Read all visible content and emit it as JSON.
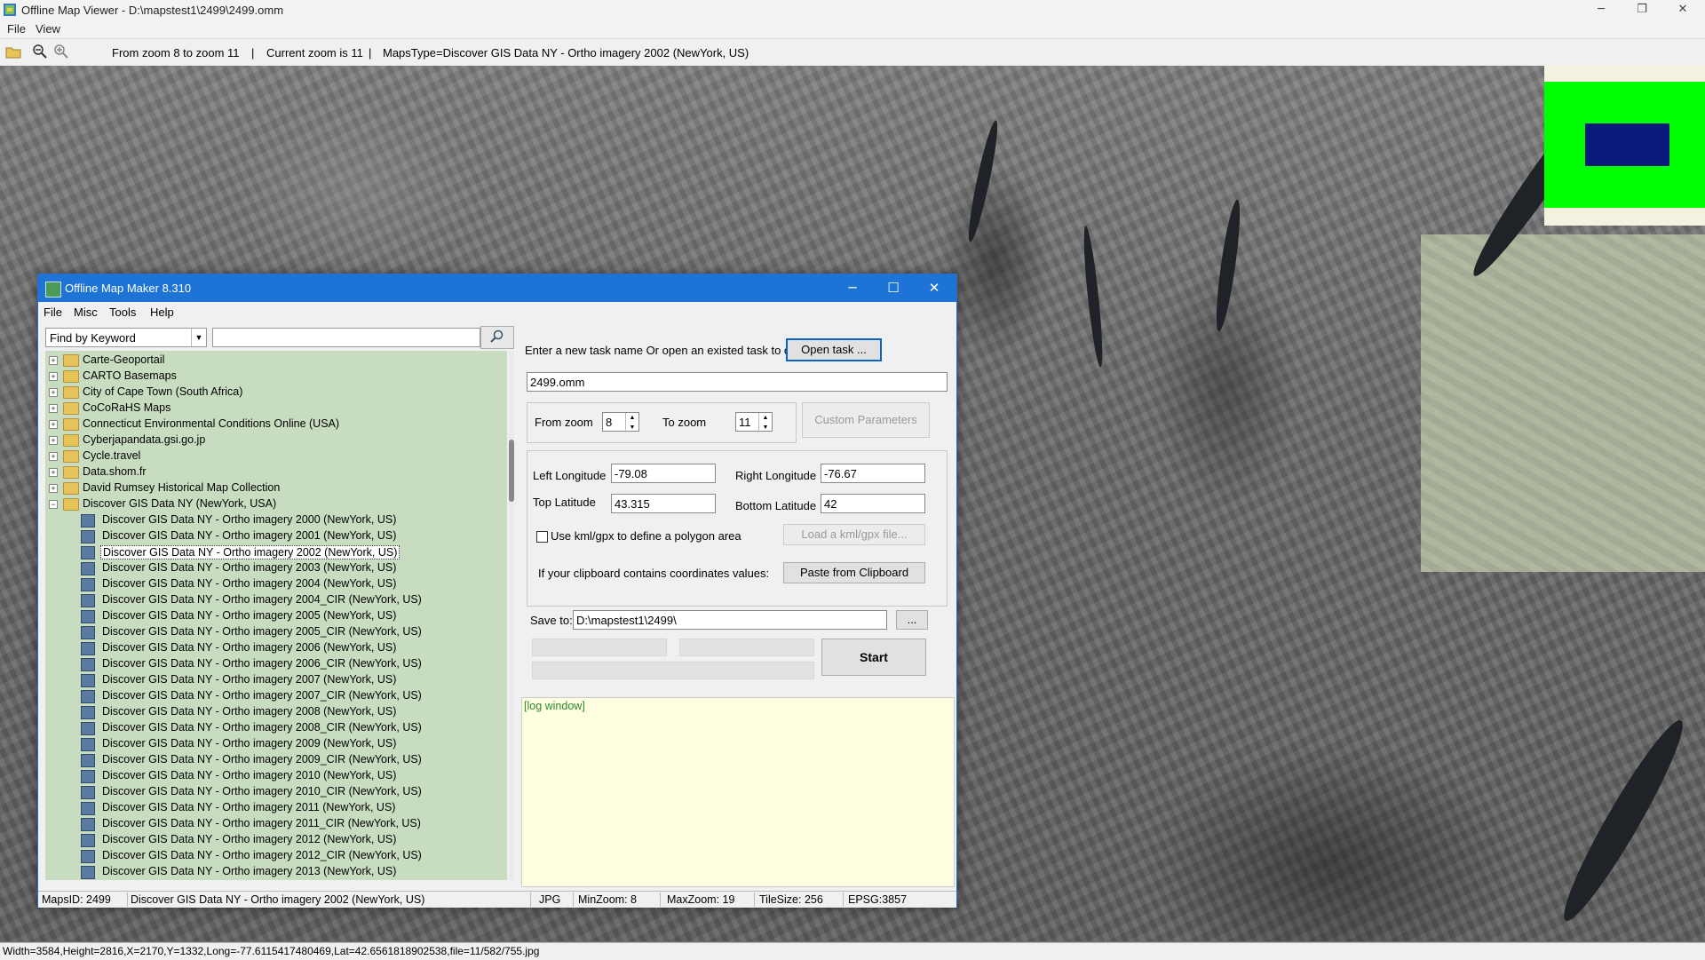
{
  "viewer": {
    "title": "Offline Map Viewer - D:\\mapstest1\\2499\\2499.omm",
    "menu": [
      "File",
      "View"
    ],
    "toolbar": {
      "zoom_range": "From zoom 8 to zoom 11",
      "current_zoom": "Current zoom is 11",
      "maps_type": "MapsType=Discover GIS Data NY - Ortho imagery 2002 (NewYork, US)"
    },
    "status": "Width=3584,Height=2816,X=2170,Y=1332,Long=-77.6115417480469,Lat=42.6561818902538,file=11/582/755.jpg"
  },
  "dialog": {
    "title": "Offline Map Maker 8.310",
    "menu": [
      "File",
      "Misc",
      "Tools",
      "Help"
    ],
    "search_mode": "Find by Keyword",
    "search_value": "",
    "tree": {
      "folders": [
        "Carte-Geoportail",
        "CARTO Basemaps",
        "City of Cape Town (South Africa)",
        "CoCoRaHS Maps",
        "Connecticut Environmental Conditions Online (USA)",
        "Cyberjapandata.gsi.go.jp",
        "Cycle.travel",
        "Data.shom.fr",
        "David Rumsey Historical Map Collection"
      ],
      "expanded_folder": "Discover GIS Data NY (NewYork, USA)",
      "children": [
        "Discover GIS Data NY - Ortho imagery 2000 (NewYork, US)",
        "Discover GIS Data NY - Ortho imagery 2001 (NewYork, US)",
        "Discover GIS Data NY - Ortho imagery 2002 (NewYork, US)",
        "Discover GIS Data NY - Ortho imagery 2003 (NewYork, US)",
        "Discover GIS Data NY - Ortho imagery 2004 (NewYork, US)",
        "Discover GIS Data NY - Ortho imagery 2004_CIR (NewYork, US)",
        "Discover GIS Data NY - Ortho imagery 2005 (NewYork, US)",
        "Discover GIS Data NY - Ortho imagery 2005_CIR (NewYork, US)",
        "Discover GIS Data NY - Ortho imagery 2006 (NewYork, US)",
        "Discover GIS Data NY - Ortho imagery 2006_CIR (NewYork, US)",
        "Discover GIS Data NY - Ortho imagery 2007 (NewYork, US)",
        "Discover GIS Data NY - Ortho imagery 2007_CIR (NewYork, US)",
        "Discover GIS Data NY - Ortho imagery 2008 (NewYork, US)",
        "Discover GIS Data NY - Ortho imagery 2008_CIR (NewYork, US)",
        "Discover GIS Data NY - Ortho imagery 2009 (NewYork, US)",
        "Discover GIS Data NY - Ortho imagery 2009_CIR (NewYork, US)",
        "Discover GIS Data NY - Ortho imagery 2010 (NewYork, US)",
        "Discover GIS Data NY - Ortho imagery 2010_CIR (NewYork, US)",
        "Discover GIS Data NY - Ortho imagery 2011 (NewYork, US)",
        "Discover GIS Data NY - Ortho imagery 2011_CIR (NewYork, US)",
        "Discover GIS Data NY - Ortho imagery 2012 (NewYork, US)",
        "Discover GIS Data NY - Ortho imagery 2012_CIR (NewYork, US)",
        "Discover GIS Data NY - Ortho imagery 2013 (NewYork, US)"
      ],
      "selected_child": "Discover GIS Data NY - Ortho imagery 2002 (NewYork, US)"
    },
    "task_prompt": "Enter a new task name Or open an existed task to continue:",
    "open_task_label": "Open task ...",
    "task_name": "2499.omm",
    "from_zoom_label": "From zoom",
    "from_zoom": "8",
    "to_zoom_label": "To zoom",
    "to_zoom": "11",
    "custom_params_label": "Custom Parameters",
    "left_lon_label": "Left Longitude",
    "left_lon": "-79.08",
    "right_lon_label": "Right Longitude",
    "right_lon": "-76.67",
    "top_lat_label": "Top Latitude",
    "top_lat": "43.315",
    "bottom_lat_label": "Bottom Latitude",
    "bottom_lat": "42",
    "kml_checkbox_label": "Use kml/gpx to define a polygon area",
    "kml_checked": false,
    "load_kml_label": "Load a kml/gpx file...",
    "clipboard_prompt": "If your clipboard contains coordinates values:",
    "paste_label": "Paste from Clipboard",
    "save_to_label": "Save to:",
    "save_to": "D:\\mapstest1\\2499\\",
    "browse_label": "...",
    "start_label": "Start",
    "log_text": "[log window]",
    "status": {
      "maps_id": "MapsID: 2499",
      "maps_name": "Discover GIS Data NY - Ortho imagery 2002 (NewYork, US)",
      "format": "JPG",
      "min_zoom": "MinZoom: 8",
      "max_zoom": "MaxZoom: 19",
      "tile_size": "TileSize: 256",
      "epsg": "EPSG:3857"
    }
  }
}
